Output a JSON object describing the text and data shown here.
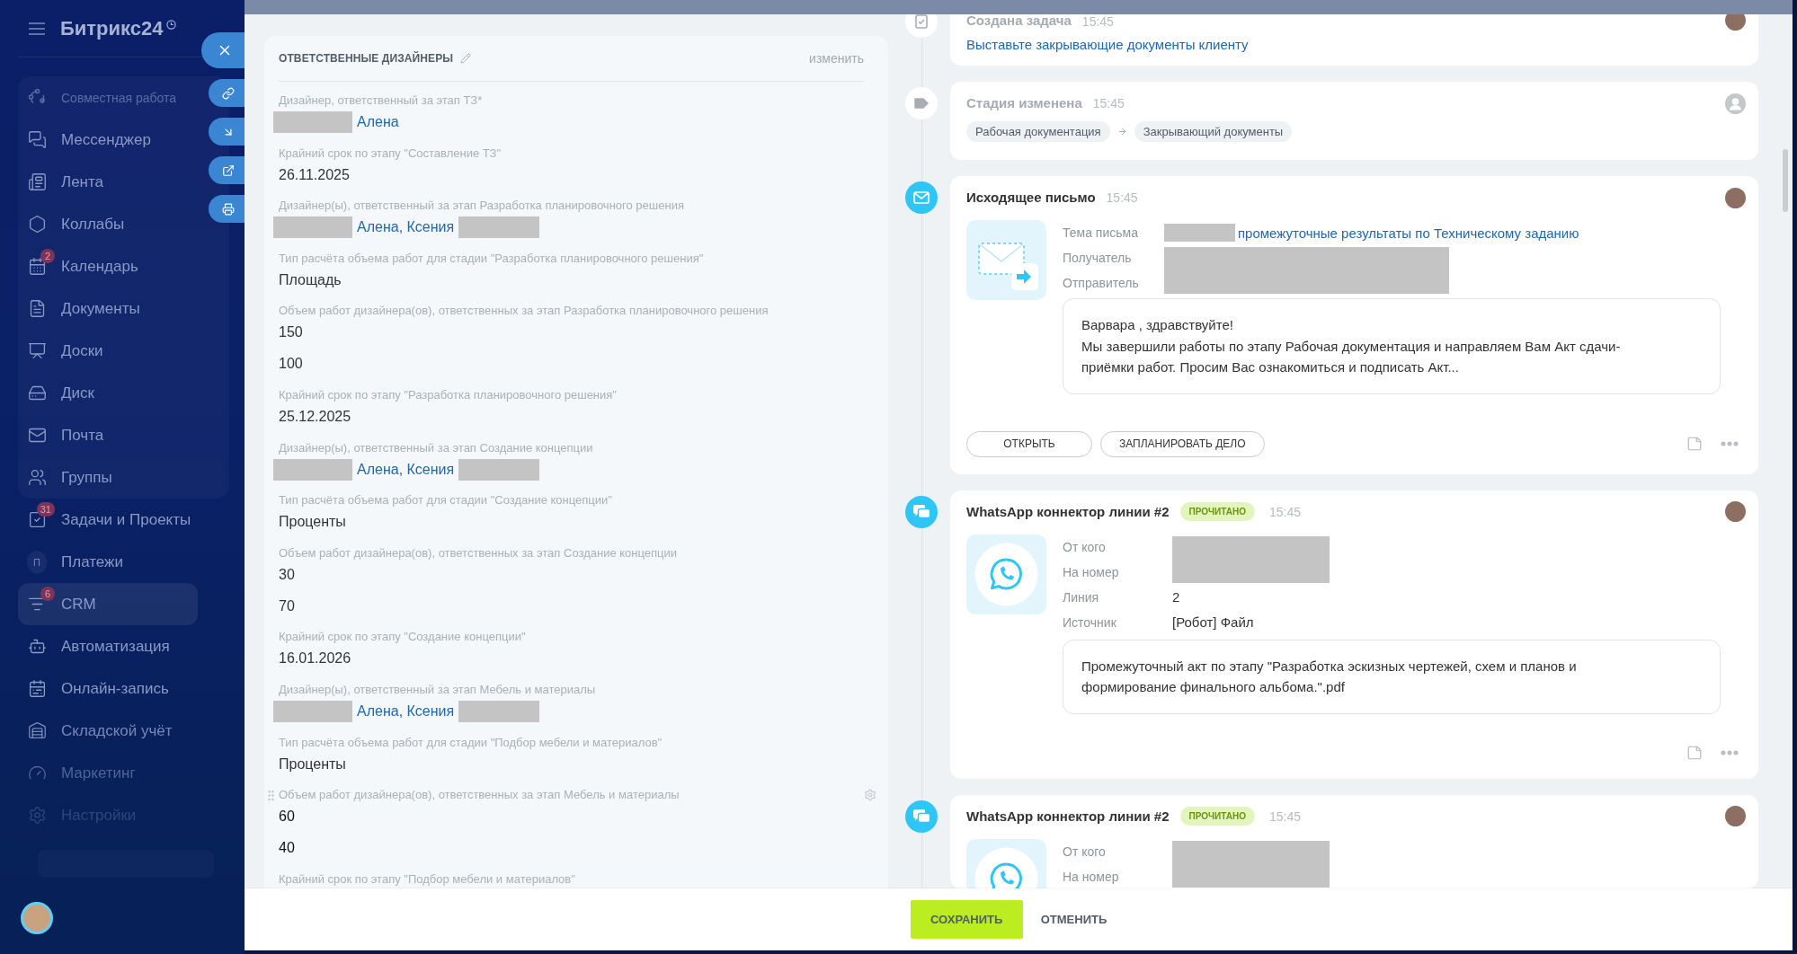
{
  "sidebar": {
    "logo": "Битрикс24",
    "sections": [
      {
        "title": "Совместная работа",
        "items": [
          {
            "label": "Мессенджер",
            "selected": false
          },
          {
            "label": "Лента",
            "selected": false
          },
          {
            "label": "Коллабы",
            "selected": false
          },
          {
            "label": "Календарь",
            "badge": "2",
            "selected": false
          },
          {
            "label": "Документы",
            "selected": false
          },
          {
            "label": "Доски",
            "selected": false
          },
          {
            "label": "Диск",
            "selected": false
          },
          {
            "label": "Почта",
            "selected": false
          },
          {
            "label": "Группы",
            "selected": false
          }
        ]
      },
      {
        "items": [
          {
            "label": "Задачи и Проекты",
            "badge": "31",
            "selected": false
          },
          {
            "label": "Платежи",
            "icon_text": "П",
            "selected": false
          },
          {
            "label": "CRM",
            "badge": "6",
            "selected": true
          },
          {
            "label": "Автоматизация",
            "selected": false
          },
          {
            "label": "Онлайн-запись",
            "selected": false
          },
          {
            "label": "Складской учёт",
            "selected": false
          },
          {
            "label": "Маркетинг",
            "selected": false
          },
          {
            "label": "Настройки",
            "selected": false
          }
        ]
      }
    ]
  },
  "designers": {
    "title": "ОТВЕТСТВЕННЫЕ ДИЗАЙНЕРЫ",
    "action": "изменить",
    "fields": [
      {
        "label": "Дизайнер, ответственный за этап ТЗ*",
        "kind": "people",
        "names": "Алена",
        "redacted_before": true,
        "redacted_after": false,
        "hovered": false
      },
      {
        "label": "Крайний срок по этапу \"Составление ТЗ\"",
        "kind": "text",
        "values": [
          "26.11.2025"
        ],
        "hovered": false
      },
      {
        "label": "Дизайнер(ы), ответственный за этап Разработка планировочного решения",
        "kind": "people",
        "names": "Алена, Ксения",
        "redacted_before": true,
        "redacted_after": true,
        "hovered": false
      },
      {
        "label": "Тип расчёта объема работ для стадии \"Разработка планировочного решения\"",
        "kind": "text",
        "values": [
          "Площадь"
        ],
        "hovered": false
      },
      {
        "label": "Объем работ дизайнера(ов), ответственных за этап Разработка планировочного решения",
        "kind": "text",
        "values": [
          "150",
          "100"
        ],
        "hovered": false
      },
      {
        "label": "Крайний срок по этапу \"Разработка планировочного решения\"",
        "kind": "text",
        "values": [
          "25.12.2025"
        ],
        "hovered": false
      },
      {
        "label": "Дизайнер(ы), ответственный за этап Создание концепции",
        "kind": "people",
        "names": "Алена, Ксения",
        "redacted_before": true,
        "redacted_after": true,
        "hovered": false
      },
      {
        "label": "Тип расчёта объема работ для стадии \"Создание концепции\"",
        "kind": "text",
        "values": [
          "Проценты"
        ],
        "hovered": false
      },
      {
        "label": "Объем работ дизайнера(ов), ответственных за этап Создание концепции",
        "kind": "text",
        "values": [
          "30",
          "70"
        ],
        "hovered": false
      },
      {
        "label": "Крайний срок по этапу \"Создание концепции\"",
        "kind": "text",
        "values": [
          "16.01.2026"
        ],
        "hovered": false
      },
      {
        "label": "Дизайнер(ы), ответственный за этап Мебель и материалы",
        "kind": "people",
        "names": "Алена, Ксения",
        "redacted_before": true,
        "redacted_after": true,
        "hovered": false
      },
      {
        "label": "Тип расчёта объема работ для стадии \"Подбор мебели и материалов\"",
        "kind": "text",
        "values": [
          "Проценты"
        ],
        "hovered": false
      },
      {
        "label": "Объем работ дизайнера(ов), ответственных за этап Мебель и материалы",
        "kind": "text",
        "values": [
          "60",
          "40"
        ],
        "hovered": true
      },
      {
        "label": "Крайний срок по этапу \"Подбор мебели и материалов\"",
        "kind": "text",
        "hovered": false
      }
    ]
  },
  "timeline": [
    {
      "kind": "task",
      "title": "Создана задача",
      "time": "15:45",
      "avatar": {
        "kind": "photo"
      },
      "link": "Выставьте закрывающие документы клиенту"
    },
    {
      "kind": "stage",
      "title": "Стадия изменена",
      "time": "15:45",
      "avatar": {
        "kind": "generic"
      },
      "stages": [
        "Рабочая документация",
        "Закрывающий документы"
      ]
    },
    {
      "kind": "email",
      "title": "Исходящее письмо",
      "time": "15:45",
      "avatar": {
        "kind": "photo"
      },
      "fields": [
        {
          "label": "Тема письма",
          "value": "промежуточные результаты по Техническому заданию",
          "link": true,
          "redacted": true
        },
        {
          "label": "Получатель",
          "redacted": true
        },
        {
          "label": "Отправитель",
          "redacted": true
        }
      ],
      "message": [
        "Варвара , здравствуйте!",
        "Мы завершили работы по этапу Рабочая документация и направляем Вам Акт сдачи-приёмки работ. Просим Вас ознакомиться и подписать Акт..."
      ],
      "buttons": [
        "ОТКРЫТЬ",
        "ЗАПЛАНИРОВАТЬ ДЕЛО"
      ],
      "tools": true
    },
    {
      "kind": "chat",
      "title": "WhatsApp коннектор линии #2",
      "badge": "ПРОЧИТАНО",
      "time": "15:45",
      "avatar": {
        "kind": "photo"
      },
      "fields": [
        {
          "label": "От кого",
          "redacted": true
        },
        {
          "label": "На номер",
          "redacted": true
        },
        {
          "label": "Линия",
          "value": "2",
          "link": false,
          "redacted": false
        },
        {
          "label": "Источник",
          "value": "[Робот] Файл",
          "link": false,
          "redacted": false
        }
      ],
      "message": [
        "Промежуточный акт по этапу \"Разработка эскизных чертежей, схем и планов и формирование финального альбома.\".pdf"
      ],
      "tools": true
    },
    {
      "kind": "chat",
      "title": "WhatsApp коннектор линии #2",
      "badge": "ПРОЧИТАНО",
      "time": "15:45",
      "avatar": {
        "kind": "photo"
      },
      "fields": [
        {
          "label": "От кого",
          "redacted": true
        },
        {
          "label": "На номер",
          "redacted": true
        }
      ]
    }
  ],
  "footer": {
    "buttons": [
      {
        "label": "СОХРАНИТЬ",
        "kind": "primary"
      },
      {
        "label": "ОТМЕНИТЬ",
        "kind": "link"
      }
    ]
  }
}
